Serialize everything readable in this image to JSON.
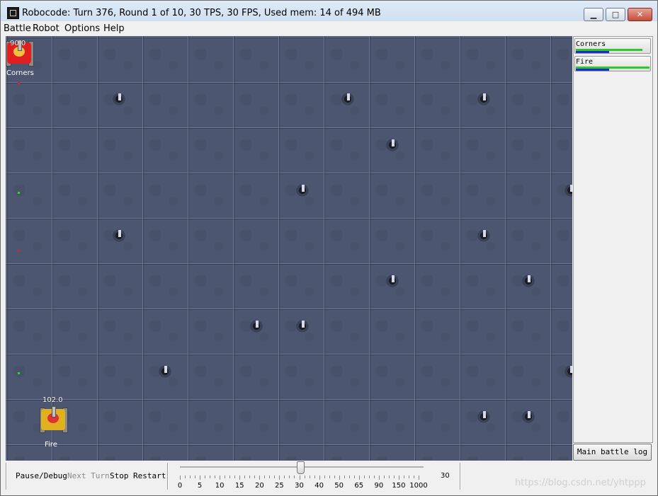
{
  "window": {
    "title": "Robocode: Turn 376, Round 1 of 10, 30 TPS, 30 FPS, Used mem: 14 of 494 MB",
    "minimize_glyph": "▁",
    "maximize_glyph": "□",
    "close_glyph": "✕"
  },
  "menu": {
    "items": [
      {
        "label": "Battle"
      },
      {
        "label": "Robot"
      },
      {
        "label": "Options"
      },
      {
        "label": "Help"
      }
    ]
  },
  "arena": {
    "robots": [
      {
        "name": "Corners",
        "energy": "90.0",
        "color": "#e02020",
        "turret_color": "#f0c040"
      },
      {
        "name": "Fire",
        "energy": "102.0",
        "color": "#e0b020",
        "turret_color": "#e03030"
      }
    ]
  },
  "robot_buttons": [
    {
      "label": "Corners",
      "energy_fraction": 0.9,
      "gun_fraction": 0.45
    },
    {
      "label": "Fire",
      "energy_fraction": 1.0,
      "gun_fraction": 0.45
    }
  ],
  "colors": {
    "energy_bar": "#2ec82e",
    "gun_heat_bar": "#1e2ec8",
    "arena_bg": "#4c5670"
  },
  "main_log_button": "Main battle log",
  "controls": {
    "pause_debug": "Pause/Debug",
    "next_turn": "Next Turn",
    "stop": "Stop",
    "restart": "Restart",
    "tps_ticks": [
      "0",
      "5",
      "10",
      "15",
      "20",
      "25",
      "30",
      "40",
      "50",
      "65",
      "90",
      "150",
      "1000"
    ],
    "tps_value": "30"
  },
  "watermark": "https://blog.csdn.net/yhtppp"
}
